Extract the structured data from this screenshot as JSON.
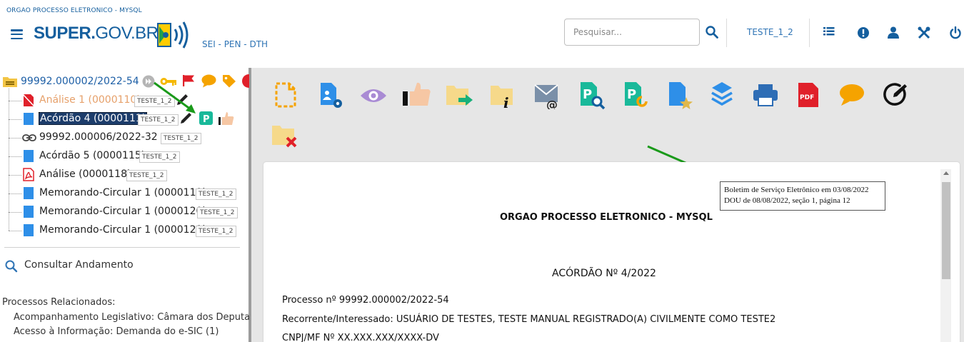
{
  "header": {
    "org": "ORGAO PROCESSO ELETRONICO - MYSQL",
    "logo_bold": "SUPER.",
    "logo_gov": "GOV.BR",
    "subtitle": "SEI - PEN - DTH",
    "search_placeholder": "Pesquisar...",
    "user": "TESTE_1_2"
  },
  "tree": {
    "root": "99992.000002/2022-54",
    "items": [
      {
        "label": "Análise 1 (0000110)",
        "tag": "TESTE_1_2"
      },
      {
        "label": "Acórdão 4 (0000111)",
        "tag": "TESTE_1_2"
      },
      {
        "label": "99992.000006/2022-32",
        "tag": "TESTE_1_2"
      },
      {
        "label": "Acórdão 5 (0000115)",
        "tag": "TESTE_1_2"
      },
      {
        "label": "Análise (0000118)",
        "tag": "TESTE_1_2"
      },
      {
        "label": "Memorando-Circular 1 (0000119)",
        "tag": "TESTE_1_2"
      },
      {
        "label": "Memorando-Circular 1 (0000120)",
        "tag": "TESTE_1_2"
      },
      {
        "label": "Memorando-Circular 1 (0000121)",
        "tag": "TESTE_1_2"
      }
    ]
  },
  "sidebar": {
    "consult": "Consultar Andamento",
    "related_title": "Processos Relacionados:",
    "related": [
      "Acompanhamento Legislativo: Câmara dos Deputa",
      "Acesso à Informação: Demanda do e-SIC (1)"
    ]
  },
  "document": {
    "stamp_line1": "Boletim de Serviço Eletrônico em 03/08/2022",
    "stamp_line2": "DOU de 08/08/2022, seção 1, página 12",
    "org": "ORGAO PROCESSO ELETRONICO - MYSQL",
    "title": "ACÓRDÃO Nº 4/2022",
    "lines": [
      "Processo nº 99992.000002/2022-54",
      "Recorrente/Interessado: USUÁRIO DE TESTES, TESTE MANUAL REGISTRADO(A) CIVILMENTE COMO TESTE2",
      "CNPJ/MF Nº XX.XXX.XXX/XXXX-DV"
    ]
  },
  "colors": {
    "brand": "#155f9e",
    "link": "#2f74b5",
    "arrow": "#1a9a1a"
  }
}
